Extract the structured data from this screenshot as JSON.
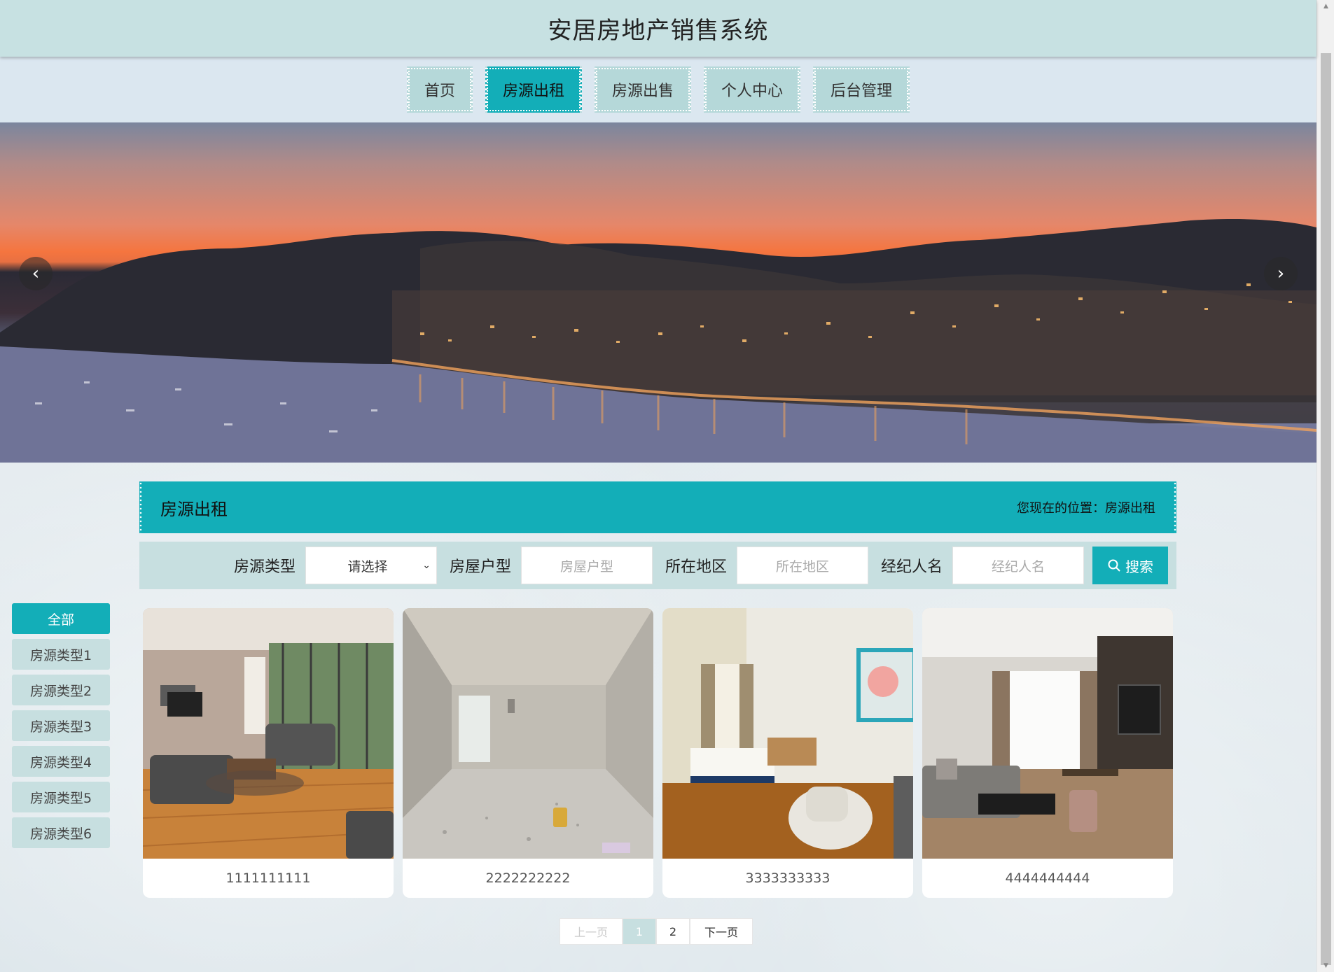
{
  "header": {
    "title": "安居房地产销售系统"
  },
  "nav": {
    "items": [
      {
        "label": "首页",
        "active": false
      },
      {
        "label": "房源出租",
        "active": true
      },
      {
        "label": "房源出售",
        "active": false
      },
      {
        "label": "个人中心",
        "active": false
      },
      {
        "label": "后台管理",
        "active": false
      }
    ]
  },
  "banner": {
    "prev_icon": "chevron-left-icon",
    "next_icon": "chevron-right-icon"
  },
  "section": {
    "title": "房源出租",
    "breadcrumb": "您现在的位置：房源出租"
  },
  "search": {
    "type_label": "房源类型",
    "type_value": "请选择",
    "layout_label": "房屋户型",
    "layout_placeholder": "房屋户型",
    "region_label": "所在地区",
    "region_placeholder": "所在地区",
    "agent_label": "经纪人名",
    "agent_placeholder": "经纪人名",
    "button_label": "搜索"
  },
  "categories": [
    {
      "label": "全部",
      "active": true
    },
    {
      "label": "房源类型1",
      "active": false
    },
    {
      "label": "房源类型2",
      "active": false
    },
    {
      "label": "房源类型3",
      "active": false
    },
    {
      "label": "房源类型4",
      "active": false
    },
    {
      "label": "房源类型5",
      "active": false
    },
    {
      "label": "房源类型6",
      "active": false
    }
  ],
  "listings": [
    {
      "title": "1111111111"
    },
    {
      "title": "2222222222"
    },
    {
      "title": "3333333333"
    },
    {
      "title": "4444444444"
    }
  ],
  "pagination": {
    "prev": "上一页",
    "pages": [
      "1",
      "2"
    ],
    "current": "1",
    "next": "下一页"
  },
  "colors": {
    "accent": "#13aeb8",
    "header_bg": "#c7e1e2",
    "nav_bg": "#dbe7f0",
    "tab_bg": "#b5d8d9"
  }
}
